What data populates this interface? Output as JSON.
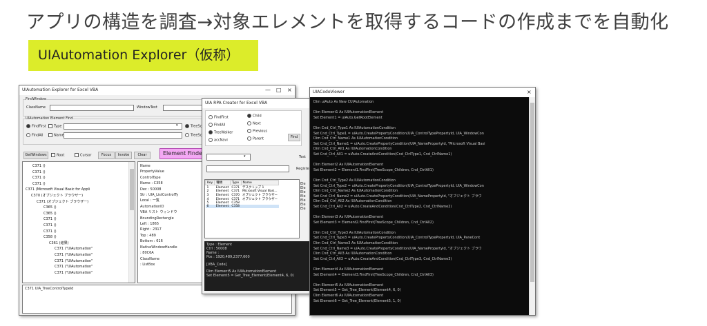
{
  "slide": {
    "title": "アプリの構造を調査→対象エレメントを取得するコードの作成までを自動化",
    "subtitle": "UIAutomation Explorer（仮称）"
  },
  "explorer": {
    "title": "UIAutomation Explorer for Excel VBA",
    "controls": {
      "minimize": "—",
      "maximize": "□",
      "close": "×"
    },
    "find_window_label": "FindWindow",
    "classname_label": "ClassName",
    "windowtext_label": "WindowText",
    "find_group_label": "UIAutomation Element Find",
    "findfirst_label": "FindFirst",
    "findall_label": "FindAll",
    "type_label": "Type",
    "name_label": "Name",
    "treescope_label": "TreeSc",
    "buttons": [
      "GetWindows",
      "Root",
      "Cursor",
      "Focus",
      "Invoke",
      "Clear"
    ],
    "element_finder_label": "Element Finder",
    "tree_items": [
      "C371 ()",
      "C371 ()",
      "C371 ()",
      "C371 ()",
      "C371 (Microsoft Visual Basic for Appli",
      "C370 (オブジェクト ブラウザー)",
      "C371 (オブジェクト ブラウザー)",
      "C365 ()",
      "C365 ()",
      "C371 ()",
      "C371 ()",
      "C371 ()",
      "C358 ()",
      "C361 (結果)",
      "C371 (\"UIAutomation\"",
      "C371 (\"UIAutomation\"",
      "C371 (\"UIAutomation\"",
      "C371 (\"UIAutomation\"",
      "C371 (\"UIAutomation\""
    ],
    "props": [
      "Name",
      "",
      "PropertyValue",
      "",
      "ControlType",
      "  Name   : C358",
      "  Dec    : 50008",
      "  Str    : UIA_ListControlTy",
      "  Local  : 一覧",
      "AutomationID",
      "VBA リスト ウィンドウ",
      "BoundingRectangle",
      "  Left   : 1865",
      "  Right  : 2317",
      "  Top    : 489",
      "  Bottom : 616",
      "NativeWindowHandle",
      "  : 80C6A",
      "ClassName",
      "  : ListBox"
    ],
    "status": "C371 UIA_TreeControlTypeId"
  },
  "rpa": {
    "title": "UIA RPA Creator for Excel VBA",
    "radios_left": [
      "FindFirst",
      "FindAll",
      "TreeWalker",
      "accNavi"
    ],
    "radios_right": [
      "Child",
      "Next",
      "Previous",
      "Parent"
    ],
    "find_label": "Find",
    "test_label": "Test",
    "register_label": "Register",
    "columns": [
      "Key",
      "種類",
      "Type",
      "Name"
    ],
    "rows": [
      [
        "1",
        "Element",
        "C371",
        "デスクトップ 1"
      ],
      [
        "2",
        "Element",
        "C371",
        "Microsoft Visual Basi..."
      ],
      [
        "3",
        "Element",
        "C370",
        "オブジェクト ブラウザー"
      ],
      [
        "4",
        "Element",
        "C371",
        "オブジェクト ブラウザー"
      ],
      [
        "5",
        "Element",
        "C358",
        ""
      ],
      [
        "6",
        "Element",
        "C358",
        ""
      ]
    ],
    "right_col": [
      "Ele",
      "Ele",
      "Ele",
      "Ele",
      "Ele",
      "Ele",
      "Ele"
    ],
    "info_lines": [
      "Type : Element",
      "Ctrl : 50008",
      "Name :",
      "Pos  : 1920,489,2377,600"
    ],
    "code_header": "[VBA_Code]",
    "code_lines": [
      "Dim Element5 As IUIAutomationElement",
      "Set Element5 = Get_Tree_Element(Element4, 6, 0)"
    ]
  },
  "viewer": {
    "title": "UIACodeViewer",
    "close": "×",
    "code_lines": [
      "Dim uiAuto As New CUIAutomation",
      "",
      "Dim Element1 As IUIAutomationElement",
      "Set Element1 = uiAuto.GetRootElement",
      "",
      "Dim Cnd_Ctrl_Type1 As IUIAutomationCondition",
      "Set Cnd_Ctrl_Type1 = uiAuto.CreatePropertyCondition(UIA_ControlTypePropertyId, UIA_WindowCon",
      "Dim Cnd_Ctrl_Name1 As IUIAutomationCondition",
      "Set Cnd_Ctrl_Name1 = uiAuto.CreatePropertyCondition(UIA_NamePropertyId, \"Microsoft Visual Basi",
      "Dim Cnd_Ctrl_All1 As IUIAutomationCondition",
      "Set Cnd_Ctrl_All1 = uiAuto.CreateAndCondition(Cnd_CtrlType1, Cnd_CtrlName1)",
      "",
      "Dim Element2 As IUIAutomationElement",
      "Set Element2 = Element1.FindFirst(TreeScope_Children, Cnd_CtrlAll1)",
      "",
      "Dim Cnd_Ctrl_Type2 As IUIAutomationCondition",
      "Set Cnd_Ctrl_Type2 = uiAuto.CreatePropertyCondition(UIA_ControlTypePropertyId, UIA_WindowCon",
      "Dim Cnd_Ctrl_Name2 As IUIAutomationCondition",
      "Set Cnd_Ctrl_Name2 = uiAuto.CreatePropertyCondition(UIA_NamePropertyId, \"オブジェクト ブラウ",
      "Dim Cnd_Ctrl_All2 As IUIAutomationCondition",
      "Set Cnd_Ctrl_All2 = uiAuto.CreateAndCondition(Cnd_CtrlType2, Cnd_CtrlName2)",
      "",
      "Dim Element3 As IUIAutomationElement",
      "Set Element3 = Element2.FindFirst(TreeScope_Children, Cnd_CtrlAll2)",
      "",
      "Dim Cnd_Ctrl_Type3 As IUIAutomationCondition",
      "Set Cnd_Ctrl_Type3 = uiAuto.CreatePropertyCondition(UIA_ControlTypePropertyId, UIA_PaneCont",
      "Dim Cnd_Ctrl_Name3 As IUIAutomationCondition",
      "Set Cnd_Ctrl_Name3 = uiAuto.CreatePropertyCondition(UIA_NamePropertyId, \"オブジェクト ブラウ",
      "Dim Cnd_Ctrl_All3 As IUIAutomationCondition",
      "Set Cnd_Ctrl_All3 = uiAuto.CreateAndCondition(Cnd_CtrlType3, Cnd_CtrlName3)",
      "",
      "Dim Element4 As IUIAutomationElement",
      "Set Element4 = Element3.FindFirst(TreeScope_Children, Cnd_CtrlAll3)",
      "",
      "Dim Element5 As IUIAutomationElement",
      "Set Element5 = Get_Tree_Element(Element4, 6, 0)",
      "Dim Element6 As IUIAutomationElement",
      "Set Element6 = Get_Tree_Element(Element5, 1, 0)"
    ]
  }
}
